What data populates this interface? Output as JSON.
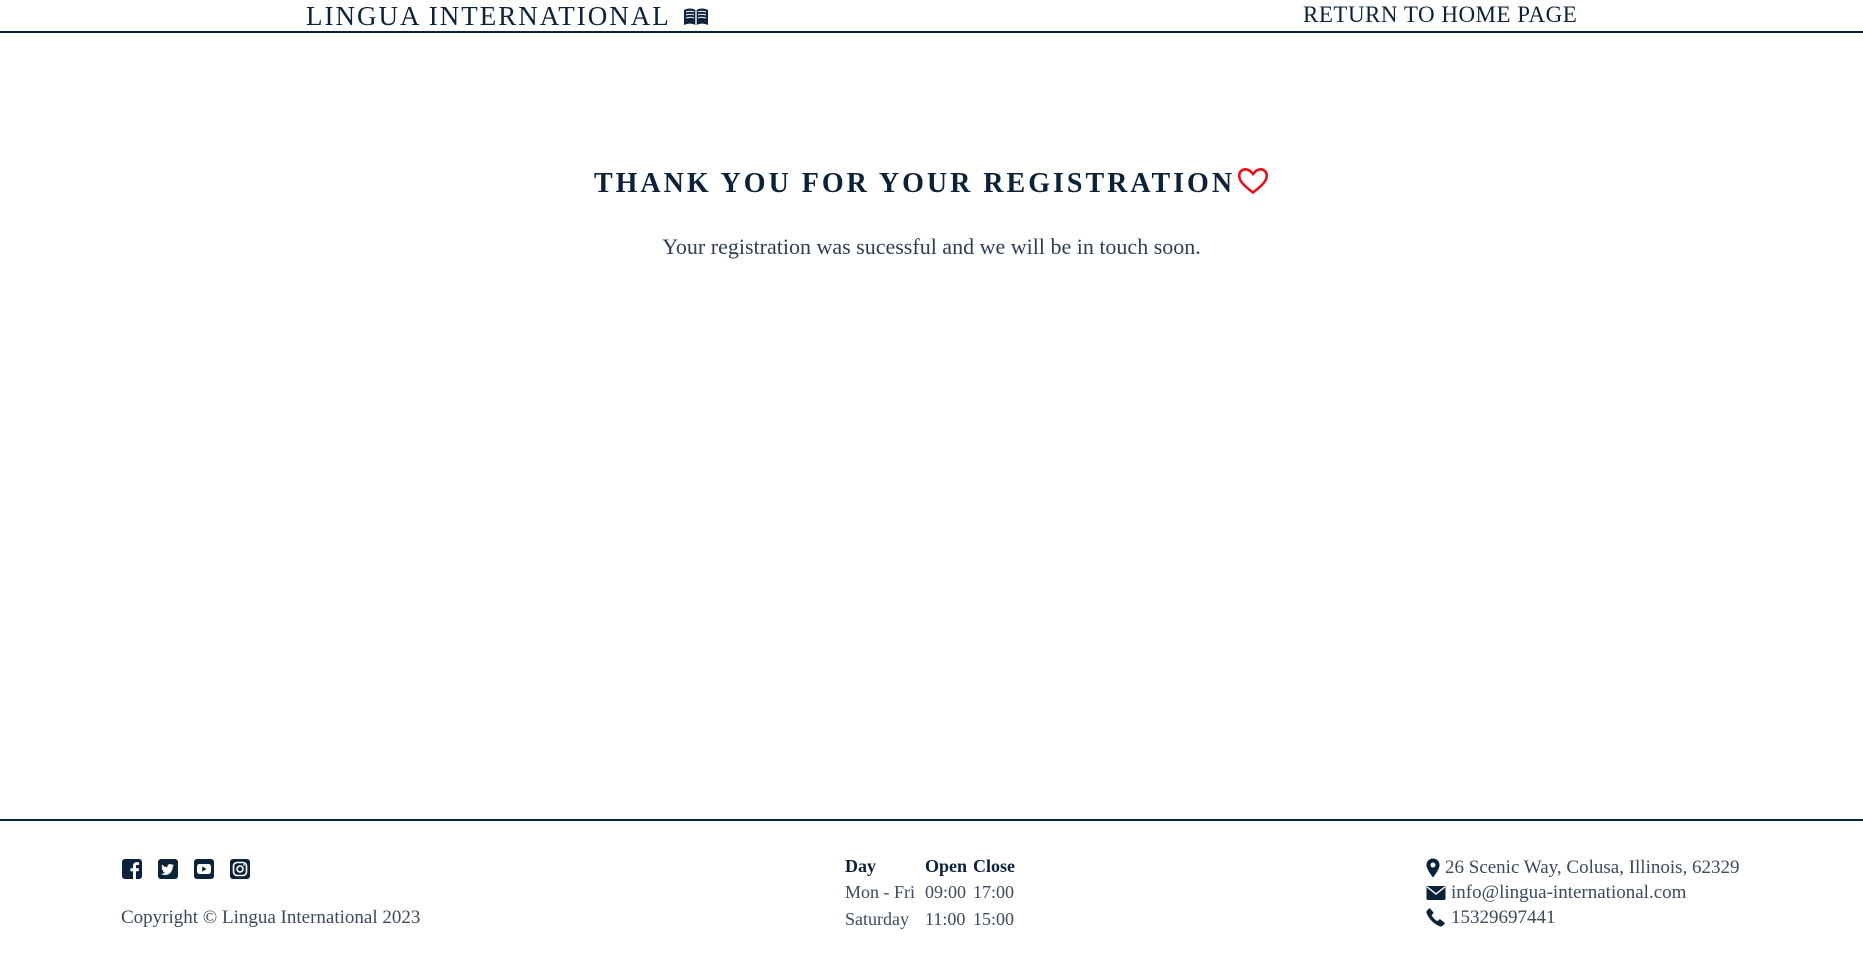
{
  "header": {
    "brand": "LINGUA INTERNATIONAL",
    "brand_icon": "book-open-icon",
    "home_link": "RETURN TO HOME PAGE"
  },
  "main": {
    "heading": "THANK YOU FOR YOUR REGISTRATION",
    "heading_icon": "heart-outline-icon",
    "message": "Your registration was sucessful and we will be in touch soon."
  },
  "footer": {
    "social": [
      "facebook-icon",
      "twitter-icon",
      "youtube-icon",
      "instagram-icon"
    ],
    "copyright": "Copyright © Lingua International 2023",
    "hours": {
      "headers": [
        "Day",
        "Open",
        "Close"
      ],
      "rows": [
        [
          "Mon - Fri",
          "09:00",
          "17:00"
        ],
        [
          "Saturday",
          "11:00",
          "15:00"
        ]
      ]
    },
    "contact": {
      "address": "26 Scenic Way, Colusa, Illinois, 62329",
      "email": "info@lingua-international.com",
      "phone": "15329697441"
    }
  },
  "colors": {
    "primary": "#0b2239",
    "heart": "#e8101a",
    "muted_text": "#3b4a5e"
  }
}
